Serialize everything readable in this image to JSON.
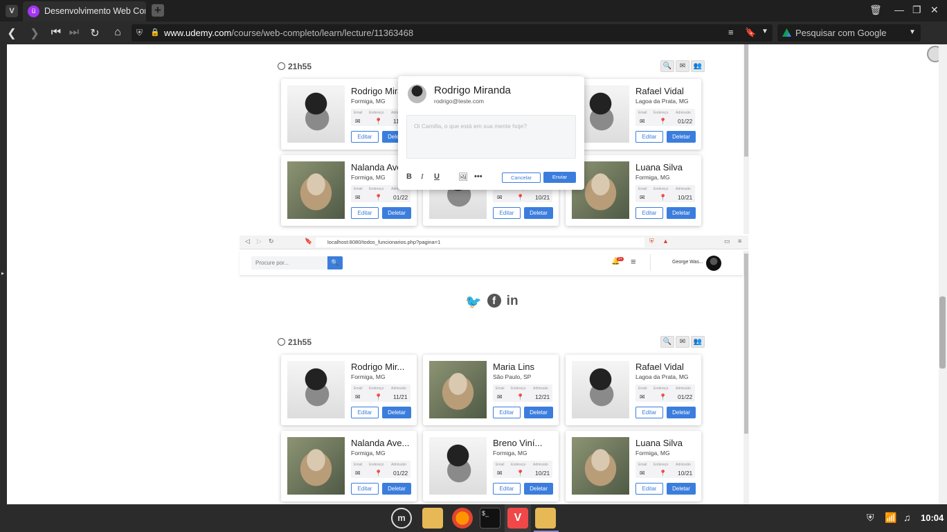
{
  "browser": {
    "tab_title": "Desenvolvimento Web Completo",
    "url_domain": "www.udemy.com",
    "url_path": "/course/web-completo/learn/lecture/11363468",
    "search_placeholder": "Pesquisar com Google"
  },
  "top_section": {
    "clock": "21h55",
    "popup": {
      "name": "Rodrigo Miranda",
      "email": "rodrigo@teste.com",
      "placeholder": "Oi Camilla, o que está em sua mente hoje?",
      "cancel": "Cancelar",
      "send": "Enviar"
    },
    "cards": [
      {
        "name": "Rodrigo Miranda",
        "location": "Formiga, MG",
        "date": "11/21",
        "photo": "man"
      },
      {
        "name": "Rafael Vidal",
        "location": "Lagoa da Prata, MG",
        "date": "01/22",
        "photo": "man"
      },
      {
        "name": "Nalanda Avelar",
        "location": "Formiga, MG",
        "date": "01/22",
        "photo": "woman"
      },
      {
        "name": "",
        "location": "",
        "date": "10/21",
        "photo": "man"
      },
      {
        "name": "Luana Silva",
        "location": "Formiga, MG",
        "date": "10/21",
        "photo": "woman"
      }
    ]
  },
  "mini_browser": {
    "url": "localhost:8080/todos_funcionarios.php?pagina=1",
    "search_placeholder": "Procure por...",
    "user": "George Was...",
    "badge": "1+"
  },
  "bottom_section": {
    "clock": "21h55",
    "cards": [
      {
        "name": "Rodrigo Mir...",
        "location": "Formiga, MG",
        "date": "11/21",
        "photo": "man"
      },
      {
        "name": "Maria Lins",
        "location": "São Paulo, SP",
        "date": "12/21",
        "photo": "woman"
      },
      {
        "name": "Rafael Vidal",
        "location": "Lagoa da Prata, MG",
        "date": "01/22",
        "photo": "man"
      },
      {
        "name": "Nalanda Ave...",
        "location": "Formiga, MG",
        "date": "01/22",
        "photo": "woman"
      },
      {
        "name": "Breno Viní...",
        "location": "Formiga, MG",
        "date": "10/21",
        "photo": "man"
      },
      {
        "name": "Luana Silva",
        "location": "Formiga, MG",
        "date": "10/21",
        "photo": "woman"
      }
    ]
  },
  "card_labels": {
    "email": "Email",
    "address": "Endereço",
    "admission": "Admissão",
    "edit": "Editar",
    "delete": "Deletar"
  },
  "taskbar": {
    "time": "10:04"
  }
}
